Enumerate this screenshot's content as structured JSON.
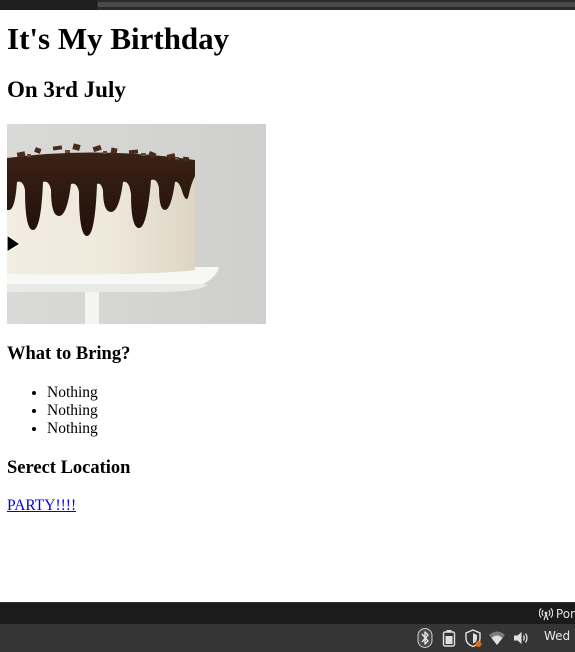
{
  "page": {
    "title": "It's My Birthday",
    "subtitle": "On 3rd July",
    "bring_heading": "What to Bring?",
    "bring_items": [
      "Nothing",
      "Nothing",
      "Nothing"
    ],
    "location_heading": "Serect Location",
    "link_text": "PARTY!!!!"
  },
  "status_bar": {
    "ports_label": "Por",
    "ports_icon": "broadcast-icon"
  },
  "tray": {
    "icons": [
      "bluetooth-icon",
      "battery-icon",
      "shield-update-icon",
      "wifi-icon",
      "volume-icon"
    ],
    "clock_text": "Wed"
  },
  "colors": {
    "link": "#0000ee",
    "status_bar_bg": "#1b1b1b",
    "tray_bg": "#353535",
    "alert_dot": "#e8691c"
  }
}
